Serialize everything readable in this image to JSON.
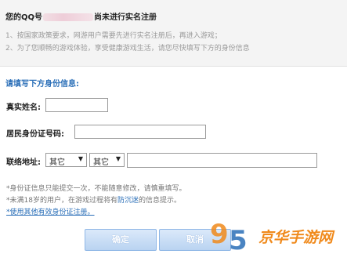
{
  "notice": {
    "title_prefix": "您的QQ号",
    "title_suffix": "尚未进行实名注册",
    "lines": [
      "1、按国家政策要求，网游用户需要先进行实名注册后，再进入游戏；",
      "2、为了您顺畅的游戏体验，享受健康游戏生活，请您尽快填写下方的身份信息"
    ]
  },
  "form": {
    "section_title": "请填写下方身份信息:",
    "name_label": "真实姓名:",
    "name_value": "",
    "id_label": "居民身份证号码:",
    "id_value": "",
    "address_label": "联络地址:",
    "province_value": "其它",
    "city_value": "其它",
    "address_value": ""
  },
  "tips": {
    "line1": "*身份证信息只能提交一次，不能随意修改，请慎重填写。",
    "line2_prefix": "*未满18岁的用户，在游戏过程将有",
    "line2_highlight": "防沉迷",
    "line2_suffix": "的信息提示。",
    "link": "*使用其他有效身份证注册。"
  },
  "buttons": {
    "confirm": "确定",
    "cancel": "取消"
  },
  "watermark": {
    "text": "京华手游网",
    "colors": {
      "orange": "#f08a1c",
      "blue": "#2b6fb8"
    }
  }
}
